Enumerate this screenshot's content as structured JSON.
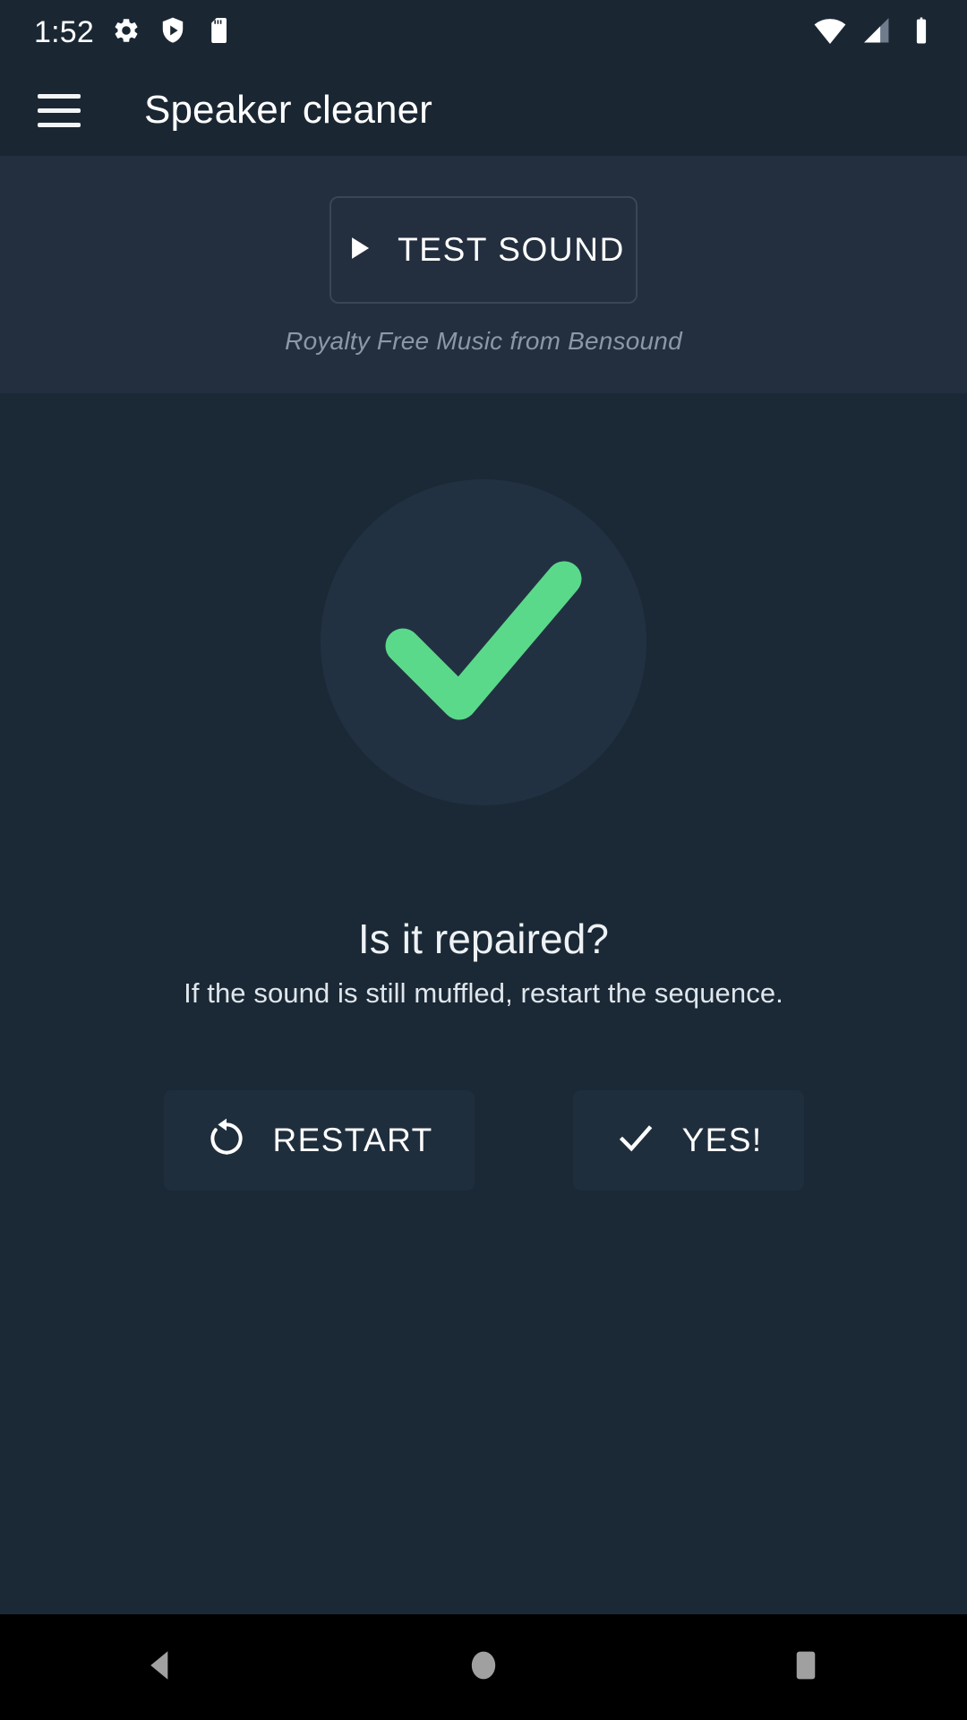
{
  "status_bar": {
    "clock": "1:52",
    "left_icons": [
      {
        "name": "settings-gear-icon"
      },
      {
        "name": "play-protect-shield-icon"
      },
      {
        "name": "sd-card-icon"
      }
    ],
    "right_icons": [
      {
        "name": "wifi-icon"
      },
      {
        "name": "cellular-signal-icon"
      },
      {
        "name": "battery-icon"
      }
    ]
  },
  "app_bar": {
    "menu_icon": "hamburger-menu-icon",
    "title": "Speaker cleaner"
  },
  "test_panel": {
    "button_label": "TEST SOUND",
    "button_icon": "play-icon",
    "attribution": "Royalty Free Music from Bensound"
  },
  "content": {
    "status_icon": "checkmark-icon",
    "title": "Is it repaired?",
    "subtitle": "If the sound is still muffled, restart the sequence.",
    "actions": [
      {
        "label": "RESTART",
        "icon": "restart-rotate-icon"
      },
      {
        "label": "YES!",
        "icon": "check-icon"
      }
    ]
  },
  "nav_bar": {
    "buttons": [
      {
        "name": "back-button",
        "icon": "back-triangle-icon"
      },
      {
        "name": "home-button",
        "icon": "home-circle-icon"
      },
      {
        "name": "recents-button",
        "icon": "recents-square-icon"
      }
    ]
  },
  "colors": {
    "page_background": "#1b2936",
    "app_bar_background": "#1a2733",
    "panel_background": "#232f3f",
    "circle_background": "#223142",
    "accent_green": "#5bd98a",
    "button_background": "#1f2e3d",
    "muted_text": "#8b98a5",
    "nav_bar_background": "#000000",
    "nav_icon": "#a0a0a0"
  }
}
